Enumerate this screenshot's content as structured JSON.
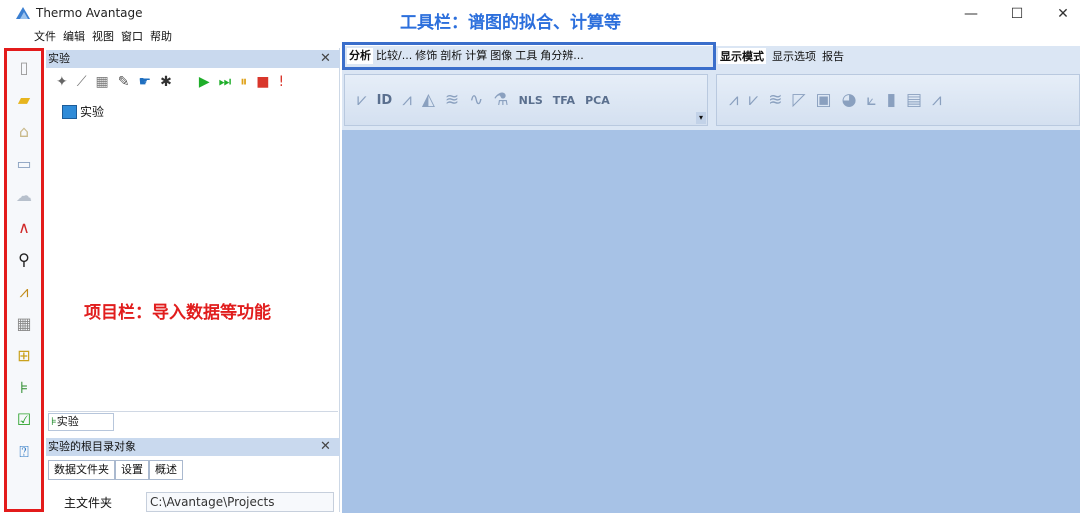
{
  "window": {
    "title": "Thermo Avantage",
    "minimize": "—",
    "maximize": "☐",
    "close": "✕"
  },
  "menu": [
    "文件",
    "编辑",
    "视图",
    "窗口",
    "帮助"
  ],
  "annotations": {
    "toolbar_note": "工具栏：谱图的拟合、计算等",
    "project_note": "项目栏：导入数据等功能"
  },
  "project_panel": {
    "title": "实验",
    "close": "✕",
    "tree_root": "实验",
    "bottom_tab": "实验"
  },
  "properties_panel": {
    "title": "实验的根目录对象",
    "close": "✕",
    "tabs": [
      "数据文件夹",
      "设置",
      "概述"
    ],
    "field_label": "主文件夹",
    "field_value": "C:\\Avantage\\Projects"
  },
  "ribbon": {
    "tabs_left": [
      "分析",
      "比较/...",
      "修饰",
      "剖析",
      "计算",
      "图像",
      "工具",
      "角分辨..."
    ],
    "tabs_right": [
      "显示模式",
      "显示选项",
      "报告"
    ],
    "tool_labels": [
      "ID",
      "NLS",
      "TFA",
      "PCA"
    ]
  },
  "colors": {
    "annotation_red": "#e11d1d",
    "annotation_blue": "#2c6fdc",
    "workspace": "#a7c2e6"
  }
}
